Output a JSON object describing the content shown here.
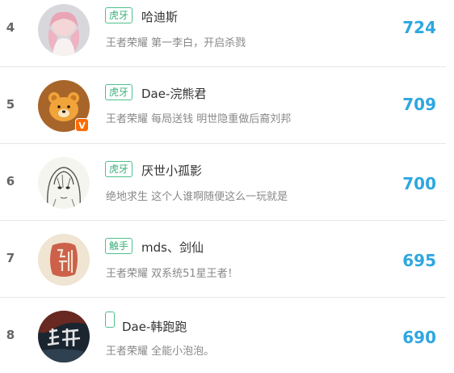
{
  "rows": [
    {
      "rank": "4",
      "tag": "虎牙",
      "name": "哈迪斯",
      "description": "王者荣耀 第一李白，开启杀戮",
      "score": "724",
      "verified": false,
      "avatar": "anime-girl-avatar"
    },
    {
      "rank": "5",
      "tag": "虎牙",
      "name": "Dae-浣熊君",
      "description": "王者荣耀 每局送钱 明世隐重做后裔刘邦",
      "score": "709",
      "verified": true,
      "verified_label": "V",
      "avatar": "bear-avatar"
    },
    {
      "rank": "6",
      "tag": "虎牙",
      "name": "厌世小孤影",
      "description": "绝地求生 这个人谁啊随便这么一玩就是",
      "score": "700",
      "verified": false,
      "avatar": "sketch-hood-avatar"
    },
    {
      "rank": "7",
      "tag": "触手",
      "name": "mds、剑仙",
      "description": "王者荣耀 双系统51星王者！",
      "score": "695",
      "verified": false,
      "avatar": "seal-stamp-avatar"
    },
    {
      "rank": "8",
      "tag": "",
      "name": "Dae-韩跑跑",
      "description": "王者荣耀 全能小泡泡。",
      "score": "690",
      "verified": false,
      "avatar": "calligraphy-avatar"
    }
  ],
  "colors": {
    "score": "#2ea7e0",
    "tag_border": "#4fc08d",
    "verified_badge": "#ff6a00"
  }
}
